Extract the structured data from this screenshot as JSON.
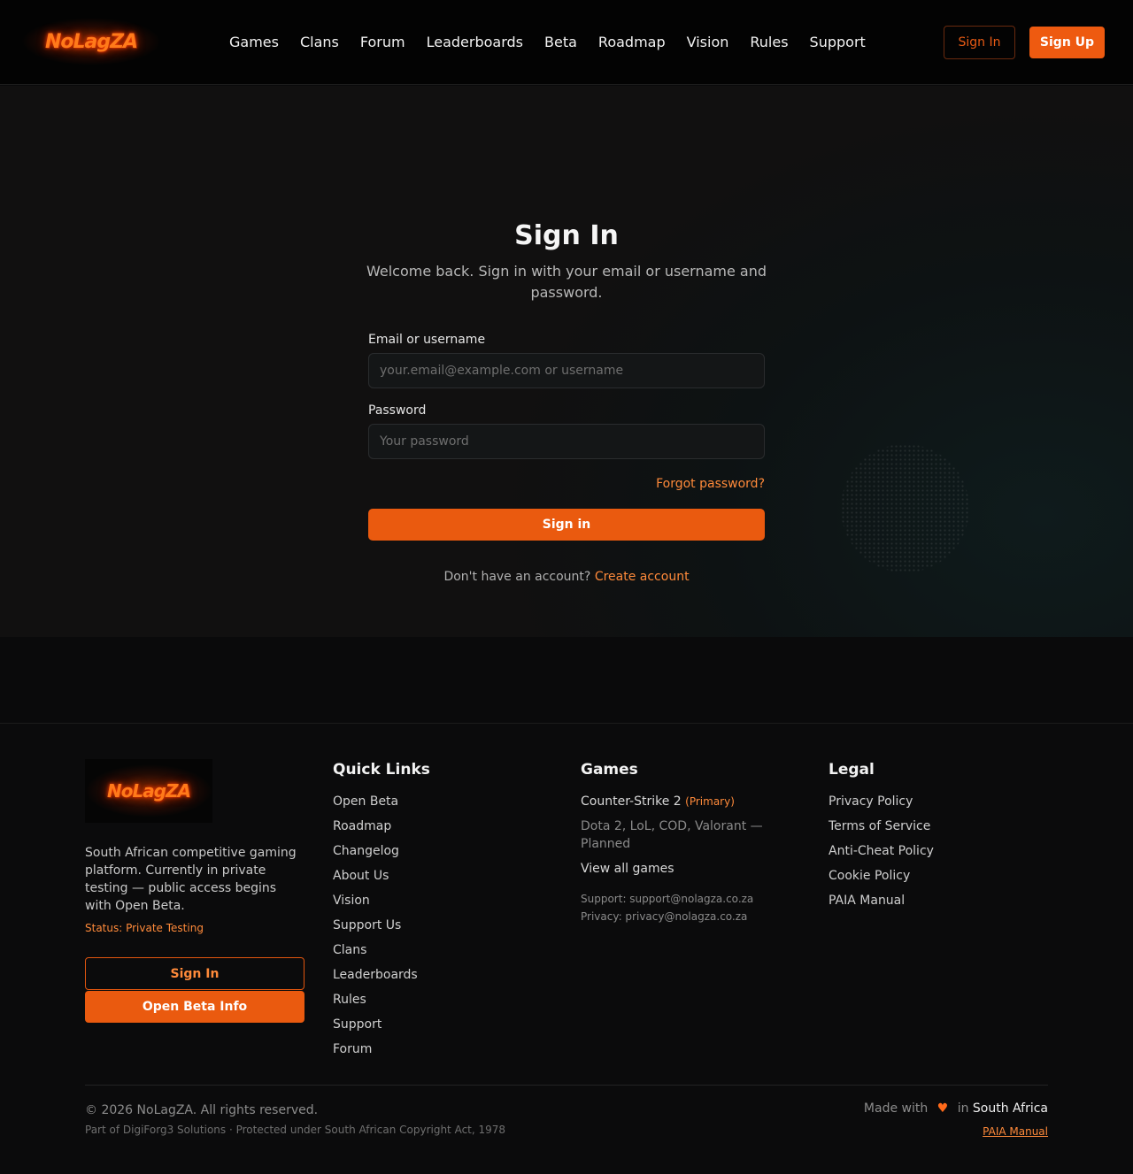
{
  "brand": {
    "name": "NoLagZA"
  },
  "nav": {
    "items": [
      "Games",
      "Clans",
      "Forum",
      "Leaderboards",
      "Beta",
      "Roadmap",
      "Vision",
      "Rules",
      "Support"
    ],
    "sign_in": "Sign In",
    "sign_up": "Sign Up"
  },
  "signin": {
    "title": "Sign In",
    "subtitle": "Welcome back. Sign in with your email or username and password.",
    "email_label": "Email or username",
    "email_placeholder": "your.email@example.com or username",
    "password_label": "Password",
    "password_placeholder": "Your password",
    "forgot": "Forgot password?",
    "submit": "Sign in",
    "no_account": "Don't have an account?",
    "create_account": "Create account"
  },
  "footer": {
    "description": "South African competitive gaming platform. Currently in private testing — public access begins with Open Beta.",
    "status": "Status: Private Testing",
    "sign_in_btn": "Sign In",
    "beta_btn": "Open Beta Info",
    "quick_links_title": "Quick Links",
    "quick_links": [
      "Open Beta",
      "Roadmap",
      "Changelog",
      "About Us",
      "Vision",
      "Support Us",
      "Clans",
      "Leaderboards",
      "Rules",
      "Support",
      "Forum"
    ],
    "games_title": "Games",
    "games": {
      "primary_game": "Counter-Strike 2",
      "primary_tag": "(Primary)",
      "planned": "Dota 2, LoL, COD, Valorant — Planned",
      "view_all": "View all games"
    },
    "support_email": "Support: support@nolagza.co.za",
    "privacy_email": "Privacy: privacy@nolagza.co.za",
    "legal_title": "Legal",
    "legal": [
      "Privacy Policy",
      "Terms of Service",
      "Anti-Cheat Policy",
      "Cookie Policy",
      "PAIA Manual"
    ],
    "copyright": "© 2026 NoLagZA. All rights reserved.",
    "copyright_sub": "Part of DigiForg3 Solutions · Protected under South African Copyright Act, 1978",
    "made_with": "Made with",
    "made_in": "in",
    "country": "South Africa",
    "paia": "PAIA Manual"
  },
  "colors": {
    "accent": "#ea5a0f",
    "accent_text": "#ff8a3a",
    "background": "#0a0a0b"
  },
  "icons": {
    "heart": "heart-icon"
  }
}
